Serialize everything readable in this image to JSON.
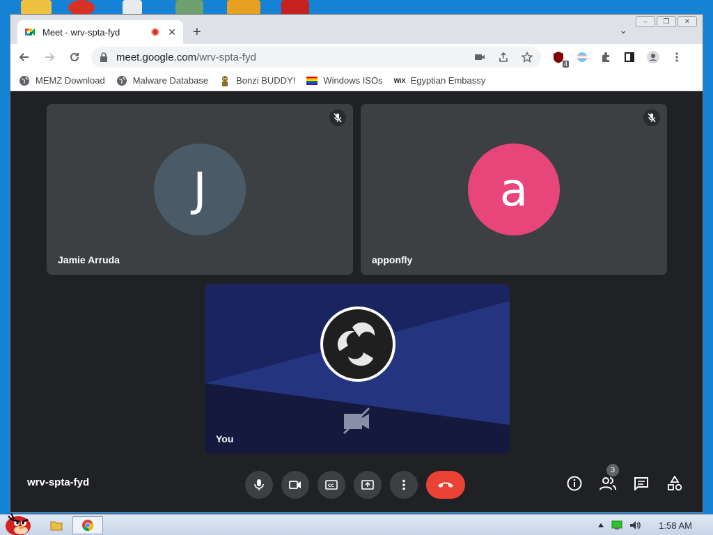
{
  "browser": {
    "tab": {
      "title": "Meet - wrv-spta-fyd",
      "close_glyph": "✕"
    },
    "new_tab_glyph": "+",
    "dropdown_glyph": "⌄",
    "window_buttons": [
      "–",
      "❐",
      "✕"
    ],
    "url": {
      "host": "meet.google.com",
      "path": "/wrv-spta-fyd"
    },
    "extension_badge": "4",
    "bookmarks": [
      {
        "label": "MEMZ Download",
        "icon": "globe-icon"
      },
      {
        "label": "Malware Database",
        "icon": "globe-icon"
      },
      {
        "label": "Bonzi BUDDY!",
        "icon": "bonzi-icon"
      },
      {
        "label": "Windows ISOs",
        "icon": "rainbow-flag-icon"
      },
      {
        "label": "Egyptian Embassy",
        "icon": "wix-icon"
      }
    ],
    "wix_text": "WiX"
  },
  "meet": {
    "participants": [
      {
        "name": "Jamie Arruda",
        "initial": "J",
        "avatar_color": "#4a5a66",
        "muted": true
      },
      {
        "name": "apponfly",
        "initial": "a",
        "avatar_color": "#e8457a",
        "muted": true
      }
    ],
    "self": {
      "name": "You",
      "camera_off": true
    },
    "meeting_code": "wrv-spta-fyd",
    "controls": [
      "microphone",
      "camera",
      "captions",
      "present",
      "more-options",
      "leave-call"
    ],
    "right_controls": [
      "info",
      "people",
      "chat",
      "activities"
    ],
    "people_count": "3"
  },
  "taskbar": {
    "clock": "1:58 AM"
  },
  "colors": {
    "meet_bg": "#202124",
    "tile_bg": "#3c4043",
    "leave_red": "#ea4335"
  }
}
